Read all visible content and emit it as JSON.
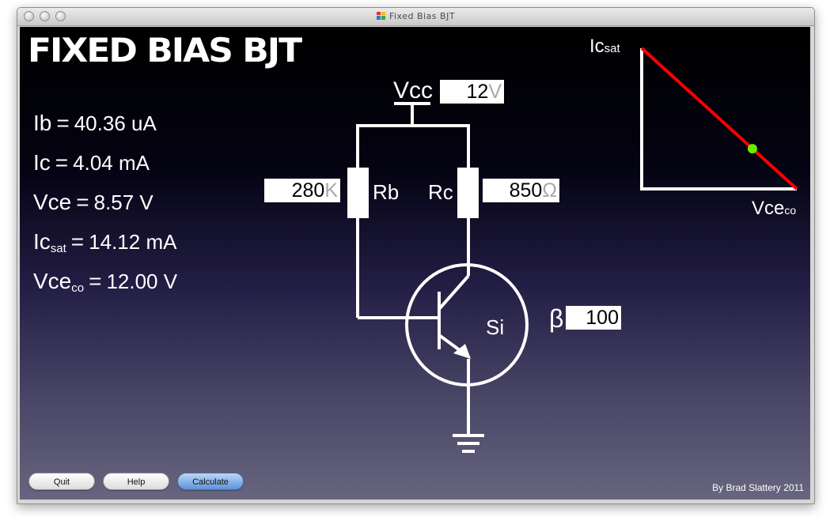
{
  "window": {
    "title": "Fixed Bias BJT"
  },
  "app": {
    "heading": "FIXED BIAS BJT"
  },
  "results": {
    "ib": {
      "label": "Ib",
      "eq": "=",
      "value": "40.36 uA"
    },
    "ic": {
      "label": "Ic",
      "eq": "=",
      "value": "4.04 mA"
    },
    "vce": {
      "label": "Vce",
      "eq": "=",
      "value": "8.57 V"
    },
    "icsat": {
      "label": "Ic",
      "sub": "sat",
      "eq": "=",
      "value": "14.12 mA"
    },
    "vceco": {
      "label": "Vce",
      "sub": "co",
      "eq": "=",
      "value": "12.00 V"
    }
  },
  "circuit": {
    "vcc_label": "Vcc",
    "vcc_value": "12",
    "vcc_unit": "V",
    "rb_label": "Rb",
    "rb_value": "280",
    "rb_unit": "K",
    "rc_label": "Rc",
    "rc_value": "850",
    "rc_unit": "Ω",
    "beta_label": "β",
    "beta_value": "100",
    "material": "Si"
  },
  "loadline": {
    "y_label": "Ic",
    "y_sub": "sat",
    "x_label": "Vce",
    "x_sub": "co",
    "q_point_fraction": 0.714,
    "line_color": "#ff0000",
    "point_color": "#66ee00"
  },
  "buttons": {
    "quit": "Quit",
    "help": "Help",
    "calculate": "Calculate"
  },
  "footer": {
    "credit": "By Brad Slattery 2011"
  }
}
